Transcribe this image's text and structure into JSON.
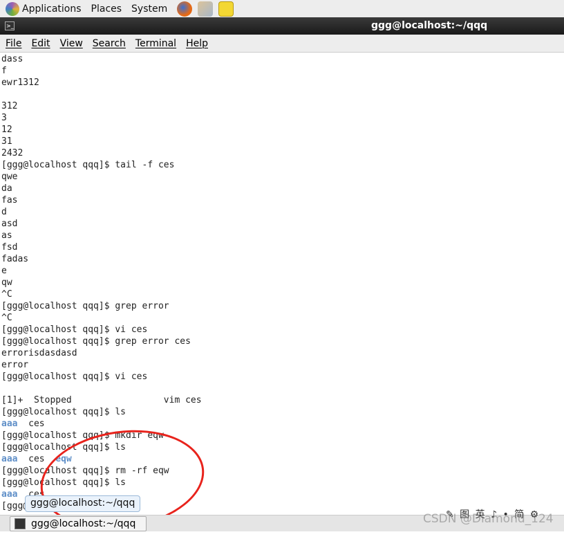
{
  "top_panel": {
    "menus": [
      "Applications",
      "Places",
      "System"
    ],
    "launchers": [
      "firefox-icon",
      "mail-icon",
      "notes-icon"
    ]
  },
  "window": {
    "title": "ggg@localhost:~/qqq"
  },
  "menubar": [
    "File",
    "Edit",
    "View",
    "Search",
    "Terminal",
    "Help"
  ],
  "terminal": {
    "lines": [
      [
        [
          "dass"
        ]
      ],
      [
        [
          "f"
        ]
      ],
      [
        [
          "ewr1312"
        ]
      ],
      [
        [
          ""
        ]
      ],
      [
        [
          "312"
        ]
      ],
      [
        [
          "3"
        ]
      ],
      [
        [
          "12"
        ]
      ],
      [
        [
          "31"
        ]
      ],
      [
        [
          "2432"
        ]
      ],
      [
        [
          "[ggg@localhost qqq]$ tail -f ces"
        ]
      ],
      [
        [
          "qwe"
        ]
      ],
      [
        [
          "da"
        ]
      ],
      [
        [
          "fas"
        ]
      ],
      [
        [
          "d"
        ]
      ],
      [
        [
          "asd"
        ]
      ],
      [
        [
          "as"
        ]
      ],
      [
        [
          "fsd"
        ]
      ],
      [
        [
          "fadas"
        ]
      ],
      [
        [
          "e"
        ]
      ],
      [
        [
          "qw"
        ]
      ],
      [
        [
          "^C"
        ]
      ],
      [
        [
          "[ggg@localhost qqq]$ grep error"
        ]
      ],
      [
        [
          "^C"
        ]
      ],
      [
        [
          "[ggg@localhost qqq]$ vi ces"
        ]
      ],
      [
        [
          "[ggg@localhost qqq]$ grep error ces"
        ]
      ],
      [
        [
          "errorisdasdasd"
        ]
      ],
      [
        [
          "error"
        ]
      ],
      [
        [
          "[ggg@localhost qqq]$ vi ces"
        ]
      ],
      [
        [
          ""
        ]
      ],
      [
        [
          "[1]+  Stopped                 vim ces"
        ]
      ],
      [
        [
          "[ggg@localhost qqq]$ ls"
        ]
      ],
      [
        [
          "aaa",
          "dir"
        ],
        [
          "  ces"
        ]
      ],
      [
        [
          "[ggg@localhost qqq]$ mkdir eqw"
        ]
      ],
      [
        [
          "[ggg@localhost qqq]$ ls"
        ]
      ],
      [
        [
          "aaa",
          "dir"
        ],
        [
          "  ces  "
        ],
        [
          "eqw",
          "dir"
        ]
      ],
      [
        [
          "[ggg@localhost qqq]$ rm -rf eqw"
        ]
      ],
      [
        [
          "[ggg@localhost qqq]$ ls"
        ]
      ],
      [
        [
          "aaa",
          "dir"
        ],
        [
          "  ces"
        ]
      ],
      [
        [
          "[ggg@localhost qqq]$ "
        ]
      ]
    ],
    "dir_color": "#5f8fc8"
  },
  "tooltip": "ggg@localhost:~/qqq",
  "taskbar": {
    "task": "ggg@localhost:~/qqq"
  },
  "tray": "✎ 图 英 ♪ • 简 ⚙",
  "watermark": "CSDN @Diamond_124",
  "annotation_color": "#e8231c"
}
